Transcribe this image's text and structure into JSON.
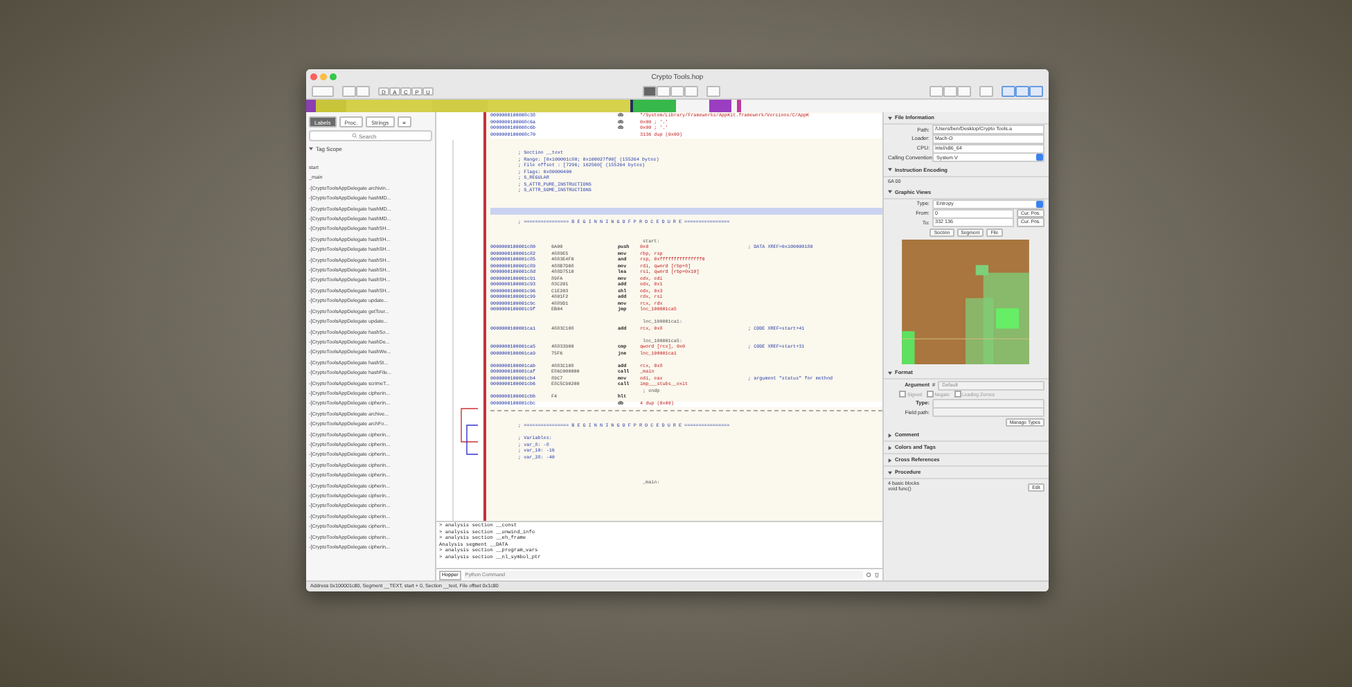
{
  "window": {
    "title": "Crypto Tools.hop"
  },
  "toolbar": {
    "mode_buttons": [
      "D",
      "A",
      "C",
      "P",
      "U"
    ]
  },
  "sidebar": {
    "tabs": [
      {
        "label": "Labels",
        "selected": true
      },
      {
        "label": "Proc.",
        "selected": false
      },
      {
        "label": "Strings",
        "selected": false
      },
      {
        "label": "≡",
        "selected": false
      }
    ],
    "search": {
      "placeholder": "Search"
    },
    "tag_scope": "Tag Scope",
    "items": [
      "start",
      "_main",
      "-[CryptoToolsAppDelegate archivin...",
      "-[CryptoToolsAppDelegate hashMD...",
      "-[CryptoToolsAppDelegate hashMD...",
      "-[CryptoToolsAppDelegate hashMD...",
      "-[CryptoToolsAppDelegate hashSH...",
      "-[CryptoToolsAppDelegate hashSH...",
      "-[CryptoToolsAppDelegate hashSH...",
      "-[CryptoToolsAppDelegate hashSH...",
      "-[CryptoToolsAppDelegate hashSH...",
      "-[CryptoToolsAppDelegate hashSH...",
      "-[CryptoToolsAppDelegate hashSH...",
      "-[CryptoToolsAppDelegate update...",
      "-[CryptoToolsAppDelegate getTour...",
      "-[CryptoToolsAppDelegate update...",
      "-[CryptoToolsAppDelegate hashSo...",
      "-[CryptoToolsAppDelegate hashDe...",
      "-[CryptoToolsAppDelegate hashWe...",
      "-[CryptoToolsAppDelegate hashSt...",
      "-[CryptoToolsAppDelegate hashFile...",
      "-[CryptoToolsAppDelegate scrimeT...",
      "-[CryptoToolsAppDelegate cipherin...",
      "-[CryptoToolsAppDelegate cipherin...",
      "-[CryptoToolsAppDelegate archive...",
      "-[CryptoToolsAppDelegate archFo...",
      "-[CryptoToolsAppDelegate cipherin...",
      "-[CryptoToolsAppDelegate cipherin...",
      "-[CryptoToolsAppDelegate cipherin...",
      "-[CryptoToolsAppDelegate cipherin...",
      "-[CryptoToolsAppDelegate cipherin...",
      "-[CryptoToolsAppDelegate cipherin...",
      "-[CryptoToolsAppDelegate cipherin...",
      "-[CryptoToolsAppDelegate cipherin...",
      "-[CryptoToolsAppDelegate cipherin...",
      "-[CryptoToolsAppDelegate cipherin...",
      "-[CryptoToolsAppDelegate cipherin...",
      "-[CryptoToolsAppDelegate cipherin..."
    ]
  },
  "code": {
    "rows": [
      {
        "kind": "data",
        "address": "0000000100008c38",
        "mnemonic": "db",
        "operands": "\"/System/Library/Frameworks/AppKit.framework/Versions/C/AppK"
      },
      {
        "kind": "data",
        "address": "0000000100008c6a",
        "mnemonic": "db",
        "operands": "0x00 ; '.'"
      },
      {
        "kind": "data",
        "address": "0000000100008c6b",
        "mnemonic": "db",
        "operands": "0x00 ; '.'"
      },
      {
        "kind": "data",
        "address": "0000000100008c70",
        "mnemonic": "",
        "operands": "3136 dup (0x00)"
      },
      {
        "kind": "blank"
      },
      {
        "kind": "blank"
      },
      {
        "kind": "comment",
        "text": "; Section __text"
      },
      {
        "kind": "comment",
        "text": "; Range: [0x100001c80; 0x100027f00[ (155264 bytes)"
      },
      {
        "kind": "comment",
        "text": "; File offset : [7296; 162560[ (155264 bytes)"
      },
      {
        "kind": "comment",
        "text": "; Flags: 0x80000400"
      },
      {
        "kind": "comment",
        "text": ";   S_REGULAR"
      },
      {
        "kind": "comment",
        "text": ";   S_ATTR_PURE_INSTRUCTIONS"
      },
      {
        "kind": "comment",
        "text": ";   S_ATTR_SOME_INSTRUCTIONS"
      },
      {
        "kind": "blank"
      },
      {
        "kind": "blank"
      },
      {
        "kind": "separator"
      },
      {
        "kind": "blank"
      },
      {
        "kind": "banner",
        "text": "; ================ B E G I N N I N G   O F   P R O C E D U R E ================"
      },
      {
        "kind": "blank"
      },
      {
        "kind": "blank"
      },
      {
        "kind": "label",
        "text": "start:"
      },
      {
        "kind": "instr",
        "address": "0000000100001c80",
        "bytes": "6A00",
        "mnemonic": "push",
        "operands": "0x0",
        "comment": "; DATA XREF=0x100000180"
      },
      {
        "kind": "instr",
        "address": "0000000100001c82",
        "bytes": "4889E5",
        "mnemonic": "mov",
        "operands": "rbp, rsp"
      },
      {
        "kind": "instr",
        "address": "0000000100001c85",
        "bytes": "4883E4F0",
        "mnemonic": "and",
        "operands": "rsp, 0xfffffffffffffff0"
      },
      {
        "kind": "instr",
        "address": "0000000100001c89",
        "bytes": "488B7D08",
        "mnemonic": "mov",
        "operands": "rdi, qword [rbp+8]"
      },
      {
        "kind": "instr",
        "address": "0000000100001c8d",
        "bytes": "488D7510",
        "mnemonic": "lea",
        "operands": "rsi, qword [rbp+0x10]"
      },
      {
        "kind": "instr",
        "address": "0000000100001c91",
        "bytes": "89FA",
        "mnemonic": "mov",
        "operands": "edx, edi"
      },
      {
        "kind": "instr",
        "address": "0000000100001c93",
        "bytes": "83C201",
        "mnemonic": "add",
        "operands": "edx, 0x1"
      },
      {
        "kind": "instr",
        "address": "0000000100001c96",
        "bytes": "C1E203",
        "mnemonic": "shl",
        "operands": "edx, 0x3"
      },
      {
        "kind": "instr",
        "address": "0000000100001c99",
        "bytes": "4801F2",
        "mnemonic": "add",
        "operands": "rdx, rsi"
      },
      {
        "kind": "instr",
        "address": "0000000100001c9c",
        "bytes": "4889D1",
        "mnemonic": "mov",
        "operands": "rcx, rdx"
      },
      {
        "kind": "instr",
        "address": "0000000100001c9f",
        "bytes": "EB04",
        "mnemonic": "jmp",
        "operands": "loc_100001ca5"
      },
      {
        "kind": "blank"
      },
      {
        "kind": "label",
        "text": "loc_100001ca1:"
      },
      {
        "kind": "instr",
        "address": "0000000100001ca1",
        "bytes": "4883C108",
        "mnemonic": "add",
        "operands": "rcx, 0x8",
        "comment": "; CODE XREF=start+41"
      },
      {
        "kind": "blank"
      },
      {
        "kind": "label",
        "text": "loc_100001ca5:"
      },
      {
        "kind": "instr",
        "address": "0000000100001ca5",
        "bytes": "48833900",
        "mnemonic": "cmp",
        "operands": "qword [rcx], 0x0",
        "comment": "; CODE XREF=start+31"
      },
      {
        "kind": "instr",
        "address": "0000000100001ca9",
        "bytes": "75F6",
        "mnemonic": "jne",
        "operands": "loc_100001ca1"
      },
      {
        "kind": "blank"
      },
      {
        "kind": "instr",
        "address": "0000000100001cab",
        "bytes": "4883C108",
        "mnemonic": "add",
        "operands": "rcx, 0x8"
      },
      {
        "kind": "instr",
        "address": "0000000100001caf",
        "bytes": "E86C000000",
        "mnemonic": "call",
        "operands": "_main"
      },
      {
        "kind": "instr",
        "address": "0000000100001cb4",
        "bytes": "89C7",
        "mnemonic": "mov",
        "operands": "edi, eax",
        "comment": "; argument \"status\" for method"
      },
      {
        "kind": "instr",
        "address": "0000000100001cb6",
        "bytes": "E8C5C90200",
        "mnemonic": "call",
        "operands": "imp___stubs__exit"
      },
      {
        "kind": "label",
        "text": "; endp"
      },
      {
        "kind": "instr",
        "address": "0000000100001cbb",
        "bytes": "F4",
        "mnemonic": "hlt",
        "operands": ""
      },
      {
        "kind": "data",
        "address": "0000000100001cbc",
        "mnemonic": "db",
        "operands": "4 dup (0x00)"
      },
      {
        "kind": "dashed"
      },
      {
        "kind": "blank"
      },
      {
        "kind": "blank"
      },
      {
        "kind": "banner",
        "text": "; ================ B E G I N N I N G   O F   P R O C E D U R E ================"
      },
      {
        "kind": "blank"
      },
      {
        "kind": "comment",
        "text": "; Variables:"
      },
      {
        "kind": "comment",
        "text": ";    var_8: -8"
      },
      {
        "kind": "comment",
        "text": ";    var_10: -16"
      },
      {
        "kind": "comment",
        "text": ";    var_28: -40"
      },
      {
        "kind": "blank"
      },
      {
        "kind": "blank"
      },
      {
        "kind": "blank"
      },
      {
        "kind": "label",
        "text": "_main:"
      }
    ]
  },
  "console": {
    "lines": [
      "> analysis section __const",
      "> analysis section __unwind_info",
      "> analysis section __eh_frame",
      "Analysis segment __DATA",
      "> analysis section __program_vars",
      "> analysis section __nl_symbol_ptr"
    ],
    "language": "Hopper",
    "placeholder": "Python Command"
  },
  "inspector": {
    "sections": [
      {
        "kind": "fileinfo",
        "title": "File Information",
        "expanded": true,
        "path": "/Users/ben/Desktop/Crypto Tools.a",
        "loader": "Mach-O",
        "cpu": "intel/x86_64",
        "calling_label": "Calling Convention:",
        "calling": "System V",
        "labels": [
          "Path:",
          "Loader:",
          "CPU:"
        ]
      },
      {
        "kind": "encoding",
        "title": "Instruction Encoding",
        "expanded": true,
        "text": "6A 00"
      },
      {
        "kind": "graphic",
        "title": "Graphic Views",
        "expanded": true,
        "type_label": "Type:",
        "type": "Entropy",
        "from_label": "From:",
        "from": "0",
        "to_label": "To:",
        "to": "332 136",
        "cur_pos": [
          "Cur. Pos.",
          "Cur. Pos."
        ],
        "buttons": [
          "Section",
          "Segment",
          "File"
        ]
      },
      {
        "kind": "format",
        "title": "Format",
        "expanded": true,
        "argument_label": "Argument",
        "argument_hash": "#",
        "argument": "Default",
        "checks": [
          {
            "label": "Signed",
            "checked": false
          },
          {
            "label": "Negate",
            "checked": false
          },
          {
            "label": "Leading Zeroes",
            "checked": false
          }
        ],
        "type_label": "Type:",
        "field_label": "Field path:",
        "manage": "Manage Types"
      },
      {
        "kind": "plain",
        "title": "Comment",
        "expanded": false
      },
      {
        "kind": "plain",
        "title": "Colors and Tags",
        "expanded": false
      },
      {
        "kind": "plain",
        "title": "Cross References",
        "expanded": false
      },
      {
        "kind": "procedure",
        "title": "Procedure",
        "expanded": true,
        "lines": [
          "4 basic blocks",
          "void func()"
        ],
        "edit": "Edit"
      }
    ]
  },
  "status_bar": "Address 0x100001c80, Segment __TEXT, start + 0, Section __text, File offset 0x1c80"
}
